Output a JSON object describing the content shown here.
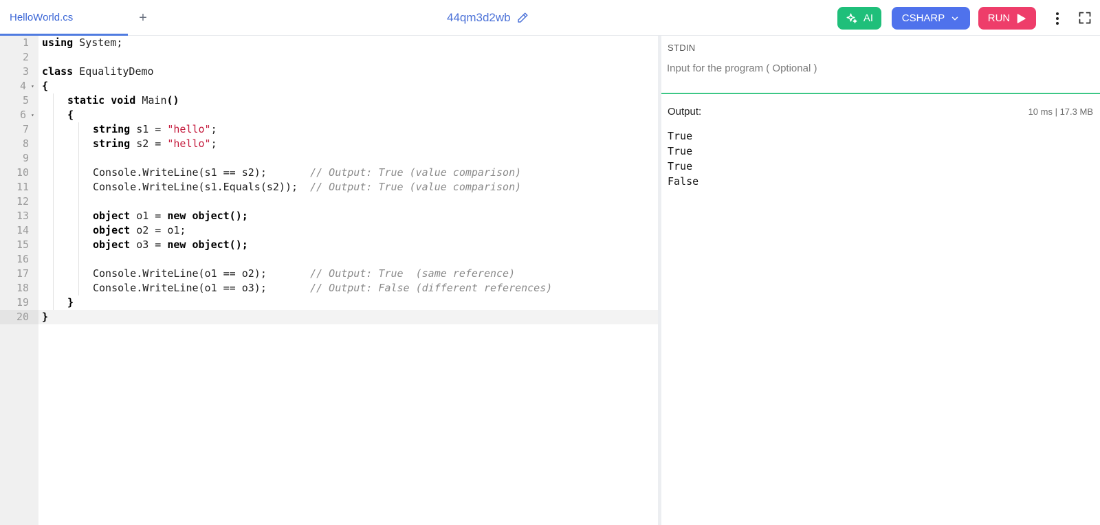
{
  "tabs": {
    "active_label": "HelloWorld.cs",
    "add_symbol": "+"
  },
  "session": {
    "id": "44qm3d2wb"
  },
  "toolbar": {
    "ai_label": "AI",
    "language_label": "CSHARP",
    "run_label": "RUN"
  },
  "colors": {
    "ai": "#1fbf7a",
    "language": "#4f72ec",
    "run": "#ee3d6a",
    "accent": "#4f7be0",
    "output_border": "#3cc786"
  },
  "icons": [
    "sparkle-icon",
    "chevron-down-icon",
    "play-icon",
    "more-vertical-icon",
    "fullscreen-icon",
    "pencil-icon",
    "fold-arrow-icon"
  ],
  "editor": {
    "active_line": 20,
    "lines": [
      {
        "n": "1",
        "fold": false,
        "indent": 0,
        "code": [
          {
            "t": "kw",
            "v": "using"
          },
          {
            "t": "p",
            "v": " System;"
          }
        ]
      },
      {
        "n": "2",
        "fold": false,
        "indent": 0,
        "code": []
      },
      {
        "n": "3",
        "fold": false,
        "indent": 0,
        "code": [
          {
            "t": "kw",
            "v": "class"
          },
          {
            "t": "p",
            "v": " EqualityDemo"
          }
        ]
      },
      {
        "n": "4",
        "fold": true,
        "indent": 0,
        "code": [
          {
            "t": "kw",
            "v": "{"
          }
        ]
      },
      {
        "n": "5",
        "fold": false,
        "indent": 1,
        "code": [
          {
            "t": "kw",
            "v": "static void"
          },
          {
            "t": "p",
            "v": " Main"
          },
          {
            "t": "kw",
            "v": "()"
          }
        ]
      },
      {
        "n": "6",
        "fold": true,
        "indent": 1,
        "code": [
          {
            "t": "kw",
            "v": "{"
          }
        ]
      },
      {
        "n": "7",
        "fold": false,
        "indent": 2,
        "code": [
          {
            "t": "kw",
            "v": "string"
          },
          {
            "t": "p",
            "v": " s1 = "
          },
          {
            "t": "str",
            "v": "\"hello\""
          },
          {
            "t": "p",
            "v": ";"
          }
        ]
      },
      {
        "n": "8",
        "fold": false,
        "indent": 2,
        "code": [
          {
            "t": "kw",
            "v": "string"
          },
          {
            "t": "p",
            "v": " s2 = "
          },
          {
            "t": "str",
            "v": "\"hello\""
          },
          {
            "t": "p",
            "v": ";"
          }
        ]
      },
      {
        "n": "9",
        "fold": false,
        "indent": 2,
        "code": []
      },
      {
        "n": "10",
        "fold": false,
        "indent": 2,
        "code": [
          {
            "t": "p",
            "v": "Console.WriteLine(s1 == s2);       "
          },
          {
            "t": "cmt",
            "v": "// Output: True (value comparison)"
          }
        ]
      },
      {
        "n": "11",
        "fold": false,
        "indent": 2,
        "code": [
          {
            "t": "p",
            "v": "Console.WriteLine(s1.Equals(s2));  "
          },
          {
            "t": "cmt",
            "v": "// Output: True (value comparison)"
          }
        ]
      },
      {
        "n": "12",
        "fold": false,
        "indent": 2,
        "code": []
      },
      {
        "n": "13",
        "fold": false,
        "indent": 2,
        "code": [
          {
            "t": "kw",
            "v": "object"
          },
          {
            "t": "p",
            "v": " o1 = "
          },
          {
            "t": "kw",
            "v": "new object();"
          }
        ]
      },
      {
        "n": "14",
        "fold": false,
        "indent": 2,
        "code": [
          {
            "t": "kw",
            "v": "object"
          },
          {
            "t": "p",
            "v": " o2 = o1;"
          }
        ]
      },
      {
        "n": "15",
        "fold": false,
        "indent": 2,
        "code": [
          {
            "t": "kw",
            "v": "object"
          },
          {
            "t": "p",
            "v": " o3 = "
          },
          {
            "t": "kw",
            "v": "new object();"
          }
        ]
      },
      {
        "n": "16",
        "fold": false,
        "indent": 2,
        "code": []
      },
      {
        "n": "17",
        "fold": false,
        "indent": 2,
        "code": [
          {
            "t": "p",
            "v": "Console.WriteLine(o1 == o2);       "
          },
          {
            "t": "cmt",
            "v": "// Output: True  (same reference)"
          }
        ]
      },
      {
        "n": "18",
        "fold": false,
        "indent": 2,
        "code": [
          {
            "t": "p",
            "v": "Console.WriteLine(o1 == o3);       "
          },
          {
            "t": "cmt",
            "v": "// Output: False (different references)"
          }
        ]
      },
      {
        "n": "19",
        "fold": false,
        "indent": 1,
        "code": [
          {
            "t": "kw",
            "v": "}"
          }
        ]
      },
      {
        "n": "20",
        "fold": false,
        "indent": 0,
        "code": [
          {
            "t": "kw",
            "v": "}"
          }
        ]
      }
    ]
  },
  "stdin": {
    "label": "STDIN",
    "placeholder": "Input for the program ( Optional )",
    "value": ""
  },
  "output": {
    "label": "Output:",
    "stats": "10 ms | 17.3 MB",
    "lines": [
      "True",
      "True",
      "True",
      "False"
    ]
  }
}
